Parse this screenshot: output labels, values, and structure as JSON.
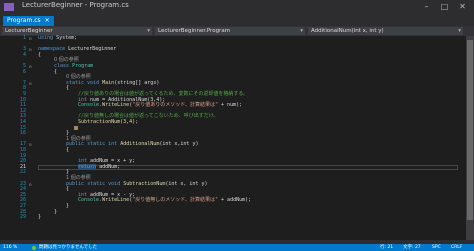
{
  "window": {
    "title": "LecturerBeginner - Program.cs",
    "min": "–",
    "max": "□",
    "close": "✕"
  },
  "tab": {
    "label": "Program.cs",
    "close": "✕"
  },
  "nav": {
    "project": "LecturerBeginner",
    "class": "LecturerBeginner.Program",
    "member": "AdditionalNum(int x, int y)"
  },
  "code": {
    "l1_num": "1",
    "l1_kw": "using",
    "l1_rest": " System;",
    "l3_num": "3",
    "l3_kw": "namespace",
    "l3_rest": " LecturerBeginner",
    "l4_num": "4",
    "l4": "{",
    "ref0": "0 個の参照",
    "l5_num": "5",
    "l5_kw": "class",
    "l5_ty": " Program",
    "l6_num": "6",
    "l6": "{",
    "ref1": "0 個の参照",
    "l7_num": "7",
    "l7_kw": "static void",
    "l7_m": " Main",
    "l7_rest": "(string[] args)",
    "l8_num": "8",
    "l8": "{",
    "l9_num": "9",
    "l9": "//戻り値ありの場合は値が返ってくるため、変数にその返却値を格納する。",
    "l10_num": "10",
    "l10_kw": "int",
    "l10_rest": " num = AdditionalNum(3,4);",
    "l11_num": "11",
    "l11_a": "Console.",
    "l11_m": "WriteLine",
    "l11_b": "(",
    "l11_str": "\"戻り値ありのメソッド、計算結果は\"",
    "l11_c": " + num);",
    "l12_num": "12",
    "l13_num": "13",
    "l13": "//戻り値無しの場合は値が返ってこないため、呼び出すだけ。",
    "l14_num": "14",
    "l14": "SubtractionNum(3,4);",
    "l15_num": "15",
    "l16_num": "16",
    "l16": "}",
    "ref2": "1 個の参照",
    "l17_num": "17",
    "l17_kw": "public static int",
    "l17_m": " AdditionalNum",
    "l17_rest": "(int x,int y)",
    "l18_num": "18",
    "l18": "{",
    "l19_num": "19",
    "l20_num": "20",
    "l20_kw": "int",
    "l20_rest": " addNum = x + y;",
    "l21_num": "21",
    "l21_kw": "return",
    "l21_rest": " addNum;",
    "l22_num": "22",
    "l22": "}",
    "ref3": "1 個の参照",
    "l23_num": "23",
    "l23_kw": "public static void",
    "l23_m": " SubtractionNum",
    "l23_rest": "(int x, int y)",
    "l24_num": "24",
    "l24": "{",
    "l25_num": "25",
    "l25_kw": "int",
    "l25_rest": " addNum = x - y;",
    "l26_num": "26",
    "l26_a": "Console.",
    "l26_m": "WriteLine",
    "l26_b": "(",
    "l26_str": "\"戻り値無しのメソッド、計算結果は\"",
    "l26_c": " + addNum);",
    "l27_num": "27",
    "l27": "}",
    "l28_num": "28",
    "l28": "}",
    "l29_num": "29",
    "l29": "}"
  },
  "status": {
    "zoom": "116 %",
    "issues": "問題は見つかりませんでした",
    "position": "行: 21",
    "col": "文字: 27",
    "spc": "SPC",
    "eol": "CRLF"
  },
  "colors": {
    "accent": "#007acc",
    "keyword": "#569cd6",
    "comment": "#57a64a",
    "string": "#d69d85"
  }
}
